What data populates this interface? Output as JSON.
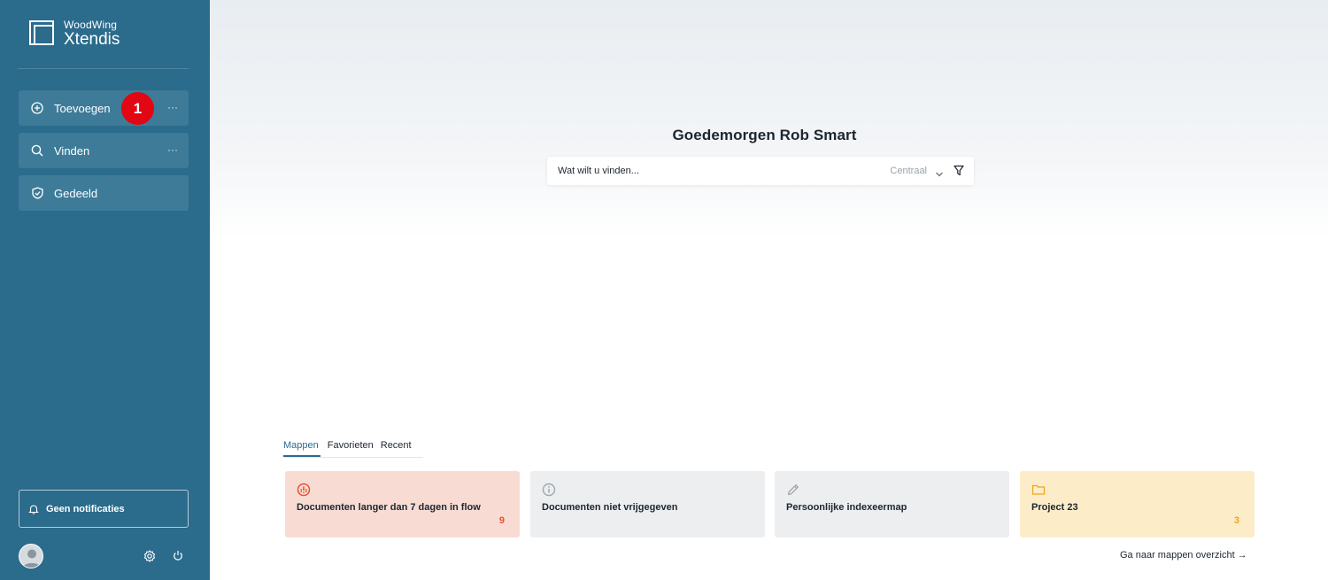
{
  "brand": {
    "line1": "WoodWing",
    "line2": "Xtendis"
  },
  "sidebar": {
    "items": [
      {
        "label": "Toevoegen",
        "icon": "plus-circle-icon",
        "more": "···"
      },
      {
        "label": "Vinden",
        "icon": "search-icon",
        "more": "···"
      },
      {
        "label": "Gedeeld",
        "icon": "shield-check-icon"
      }
    ],
    "badge": "1",
    "notifications": "Geen notificaties"
  },
  "main": {
    "greeting": "Goedemorgen Rob Smart",
    "search": {
      "placeholder": "Wat wilt u vinden...",
      "scope": "Centraal"
    },
    "tabs": [
      "Mappen",
      "Favorieten",
      "Recent"
    ],
    "cards": [
      {
        "title": "Documenten langer dan 7 dagen in flow",
        "count": "9",
        "icon": "alert-circle-icon"
      },
      {
        "title": "Documenten niet vrijgegeven",
        "count": "",
        "icon": "info-circle-icon"
      },
      {
        "title": "Persoonlijke indexeermap",
        "count": "",
        "icon": "pencil-icon"
      },
      {
        "title": "Project 23",
        "count": "3",
        "icon": "folder-icon"
      }
    ],
    "overview_link": "Ga naar mappen overzicht →"
  },
  "colors": {
    "sidebar": "#2b6b8c",
    "nav_item": "#3d7b99",
    "badge": "#e30613",
    "card_red": "#f8dcd4",
    "card_grey": "#eceef0",
    "card_yellow": "#fcecc8",
    "accent": "#2b6b8c"
  }
}
